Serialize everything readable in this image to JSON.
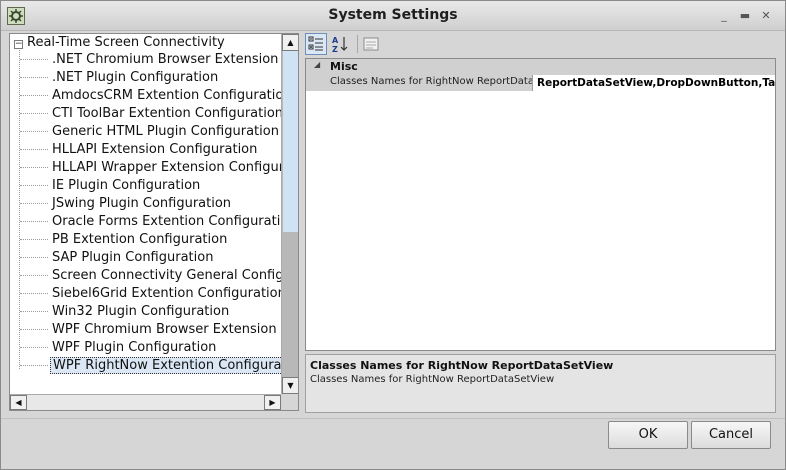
{
  "window": {
    "title": "System Settings",
    "minimize": "_",
    "maximize": "▬",
    "close": "✕"
  },
  "tree": {
    "root_label": "Real-Time Screen Connectivity",
    "items": [
      {
        "label": ".NET Chromium Browser Extension"
      },
      {
        "label": ".NET Plugin Configuration"
      },
      {
        "label": "AmdocsCRM Extention Configuration"
      },
      {
        "label": "CTI ToolBar Extention Configuration"
      },
      {
        "label": "Generic HTML Plugin Configuration"
      },
      {
        "label": "HLLAPI Extension Configuration"
      },
      {
        "label": "HLLAPI Wrapper Extension Configur"
      },
      {
        "label": "IE Plugin Configuration"
      },
      {
        "label": "JSwing Plugin Configuration"
      },
      {
        "label": "Oracle Forms Extention Configuratio"
      },
      {
        "label": "PB Extention Configuration"
      },
      {
        "label": "SAP Plugin Configuration"
      },
      {
        "label": "Screen Connectivity General Configu"
      },
      {
        "label": "Siebel6Grid Extention Configuration"
      },
      {
        "label": "Win32 Plugin Configuration"
      },
      {
        "label": "WPF Chromium Browser Extension C"
      },
      {
        "label": "WPF Plugin Configuration"
      },
      {
        "label": "WPF RightNow Extention Configurati",
        "selected": true
      }
    ]
  },
  "property_grid": {
    "category": "Misc",
    "property_name": "Classes Names for RightNow ReportDataSetView",
    "property_value": "ReportDataSetView,DropDownButton,TabControl"
  },
  "description": {
    "title": "Classes Names for RightNow ReportDataSetView",
    "text": "Classes Names for RightNow ReportDataSetView"
  },
  "buttons": {
    "ok": "OK",
    "cancel": "Cancel"
  }
}
